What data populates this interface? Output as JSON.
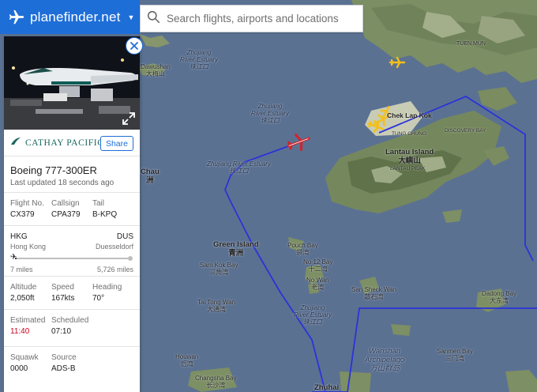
{
  "app": {
    "brand": "planefinder.net",
    "accent": "#1e6ed8"
  },
  "search": {
    "placeholder": "Search flights, airports and locations"
  },
  "panel": {
    "airline": "CATHAY PACIFIC",
    "share_label": "Share",
    "aircraft_type": "Boeing 777-300ER",
    "last_updated": "Last updated 18 seconds ago",
    "ids": [
      {
        "label": "Flight No.",
        "value": "CX379"
      },
      {
        "label": "Callsign",
        "value": "CPA379"
      },
      {
        "label": "Tail",
        "value": "B-KPQ"
      }
    ],
    "route": {
      "origin_code": "HKG",
      "origin_city": "Hong Kong",
      "dest_code": "DUS",
      "dest_city": "Duesseldorf",
      "flown": "7 miles",
      "remaining": "5,726 miles",
      "progress_fraction": 0.01
    },
    "telemetry": [
      {
        "label": "Altitude",
        "value": "2,050ft"
      },
      {
        "label": "Speed",
        "value": "167kts"
      },
      {
        "label": "Heading",
        "value": "70°"
      }
    ],
    "times": [
      {
        "label": "Estimated",
        "value": "11:40",
        "color": "#d0021b"
      },
      {
        "label": "Scheduled",
        "value": "07:10"
      }
    ],
    "misc": [
      {
        "label": "Squawk",
        "value": "0000"
      },
      {
        "label": "Source",
        "value": "ADS-B"
      }
    ]
  },
  "map": {
    "labels": {
      "zhujiang_top": "Zhujiang\nRiver Estuary\n珠江口",
      "zhujiang_mid": "Zhujiang\nRiver Estuary\n珠江口",
      "zhujiang_left": "Zhujiang River Estuary\n珠江口",
      "zhujiang_bottom": "Zhujiang\nRiver Estuary\n珠江口",
      "dawushan": "Dawushan\n大梅山",
      "chau": "Chau\n洲",
      "tuen_mun": "TUEN MUN",
      "chek_lap_kok": "Chek Lap Kok",
      "tung_chung": "TUNG CHUNG",
      "discovery_bay": "DISCOVERY BAY",
      "lantau_island": "Lantau Island\n大嶼山",
      "lantau_peak": "LANTAU PEAK",
      "green_island": "Green Island\n青洲",
      "sam_kok_bay": "Sam Kok Bay\n三角湾",
      "pouch_bay": "Pouch Bay\n袋湾",
      "no12_bay": "No 12 Bay\n十二湾",
      "no_wan": "No Wan\n老湾",
      "tai_tong_wan": "Tai Tong Wan\n大通湾",
      "san_sheck_wan": "San Sheck Wan\n散石湾",
      "dadong_bay": "Dadong Bay\n大东湾",
      "wanshan": "Wanshan\nArchipelago\n万山群岛",
      "sanmen_bay": "Sanmen Bay\n三门湾",
      "houwan": "Houwan\n后湾",
      "changsha_bay": "Changsha Bay\n长沙湾",
      "zhuhai": "Zhuhai"
    }
  }
}
